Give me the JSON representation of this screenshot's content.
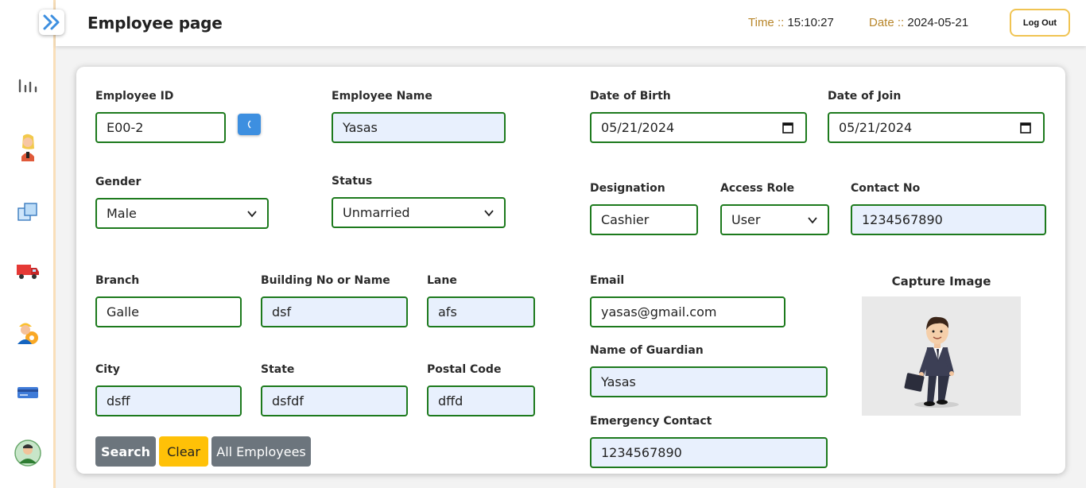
{
  "header": {
    "title": "Employee page",
    "time_label": "Time ::",
    "time_value": "15:10:27",
    "date_label": "Date ::",
    "date_value": "2024-05-21",
    "logout_label": "Log Out"
  },
  "sidebar": {
    "icons": [
      "toggle-chevrons-icon",
      "bar-chart-icon",
      "employee-avatar-icon",
      "squares-icon",
      "delivery-truck-icon",
      "worker-gear-icon",
      "credit-card-icon",
      "user-avatar-icon"
    ]
  },
  "form": {
    "employee_id": {
      "label": "Employee ID",
      "value": "E00-2"
    },
    "employee_name": {
      "label": "Employee Name",
      "value": "Yasas"
    },
    "dob": {
      "label": "Date of Birth",
      "value": "05/21/2024"
    },
    "doj": {
      "label": "Date of Join",
      "value": "05/21/2024"
    },
    "gender": {
      "label": "Gender",
      "value": "Male"
    },
    "status": {
      "label": "Status",
      "value": "Unmarried"
    },
    "designation": {
      "label": "Designation",
      "value": "Cashier"
    },
    "access_role": {
      "label": "Access Role",
      "value": "User"
    },
    "contact": {
      "label": "Contact No",
      "value": "1234567890"
    },
    "branch": {
      "label": "Branch",
      "value": "Galle"
    },
    "building": {
      "label": "Building No or Name",
      "value": "dsf"
    },
    "lane": {
      "label": "Lane",
      "value": "afs"
    },
    "email": {
      "label": "Email",
      "value": "yasas@gmail.com"
    },
    "capture_label": "Capture Image",
    "city": {
      "label": "City",
      "value": "dsff"
    },
    "state": {
      "label": "State",
      "value": "dsfdf"
    },
    "postal": {
      "label": "Postal Code",
      "value": "dffd"
    },
    "guardian": {
      "label": "Name of Guardian",
      "value": "Yasas"
    },
    "emergency": {
      "label": "Emergency Contact",
      "value": "1234567890"
    }
  },
  "buttons": {
    "search": "Search",
    "clear": "Clear",
    "all_employees": "All Employees"
  },
  "colors": {
    "accent_blue": "#3d8fe0",
    "input_border": "#1d7a1d",
    "autofill_bg": "#e8f0fd",
    "header_label": "#b8862b",
    "logout_border": "#f0c453",
    "btn_gray": "#6c757d",
    "btn_yellow": "#ffc107"
  }
}
